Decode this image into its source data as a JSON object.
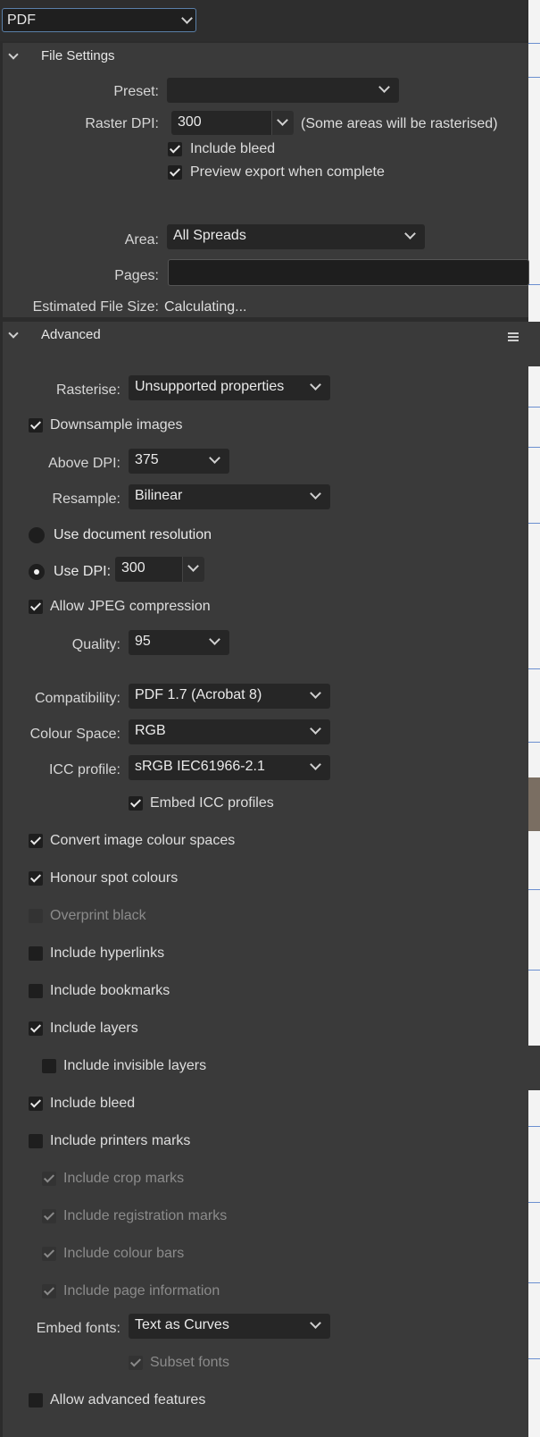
{
  "format": {
    "value": "PDF"
  },
  "file_settings": {
    "title": "File Settings",
    "preset_label": "Preset:",
    "preset_value": "",
    "raster_dpi_label": "Raster DPI:",
    "raster_dpi_value": "300",
    "raster_note": "(Some areas will be rasterised)",
    "include_bleed": "Include bleed",
    "preview_export": "Preview export when complete",
    "area_label": "Area:",
    "area_value": "All Spreads",
    "pages_label": "Pages:",
    "pages_value": "",
    "estimated_label": "Estimated File Size:",
    "estimated_value": "Calculating..."
  },
  "advanced": {
    "title": "Advanced",
    "rasterise_label": "Rasterise:",
    "rasterise_value": "Unsupported properties",
    "downsample": "Downsample images",
    "above_dpi_label": "Above DPI:",
    "above_dpi_value": "375",
    "resample_label": "Resample:",
    "resample_value": "Bilinear",
    "use_doc_res": "Use document resolution",
    "use_dpi_label": "Use DPI:",
    "use_dpi_value": "300",
    "allow_jpeg": "Allow JPEG compression",
    "quality_label": "Quality:",
    "quality_value": "95",
    "compat_label": "Compatibility:",
    "compat_value": "PDF 1.7 (Acrobat 8)",
    "colour_space_label": "Colour Space:",
    "colour_space_value": "RGB",
    "icc_label": "ICC profile:",
    "icc_value": "sRGB IEC61966-2.1",
    "embed_icc": "Embed ICC profiles",
    "convert_colour": "Convert image colour spaces",
    "honour_spot": "Honour spot colours",
    "overprint_black": "Overprint black",
    "include_hyperlinks": "Include hyperlinks",
    "include_bookmarks": "Include bookmarks",
    "include_layers": "Include layers",
    "include_invisible_layers": "Include invisible layers",
    "include_bleed": "Include bleed",
    "include_printers_marks": "Include printers marks",
    "include_crop_marks": "Include crop marks",
    "include_registration_marks": "Include registration marks",
    "include_colour_bars": "Include colour bars",
    "include_page_info": "Include page information",
    "embed_fonts_label": "Embed fonts:",
    "embed_fonts_value": "Text as Curves",
    "subset_fonts": "Subset fonts",
    "allow_advanced": "Allow advanced features"
  },
  "colors": {
    "panel": "#3a3a3a",
    "accent": "#5a7fa8"
  }
}
